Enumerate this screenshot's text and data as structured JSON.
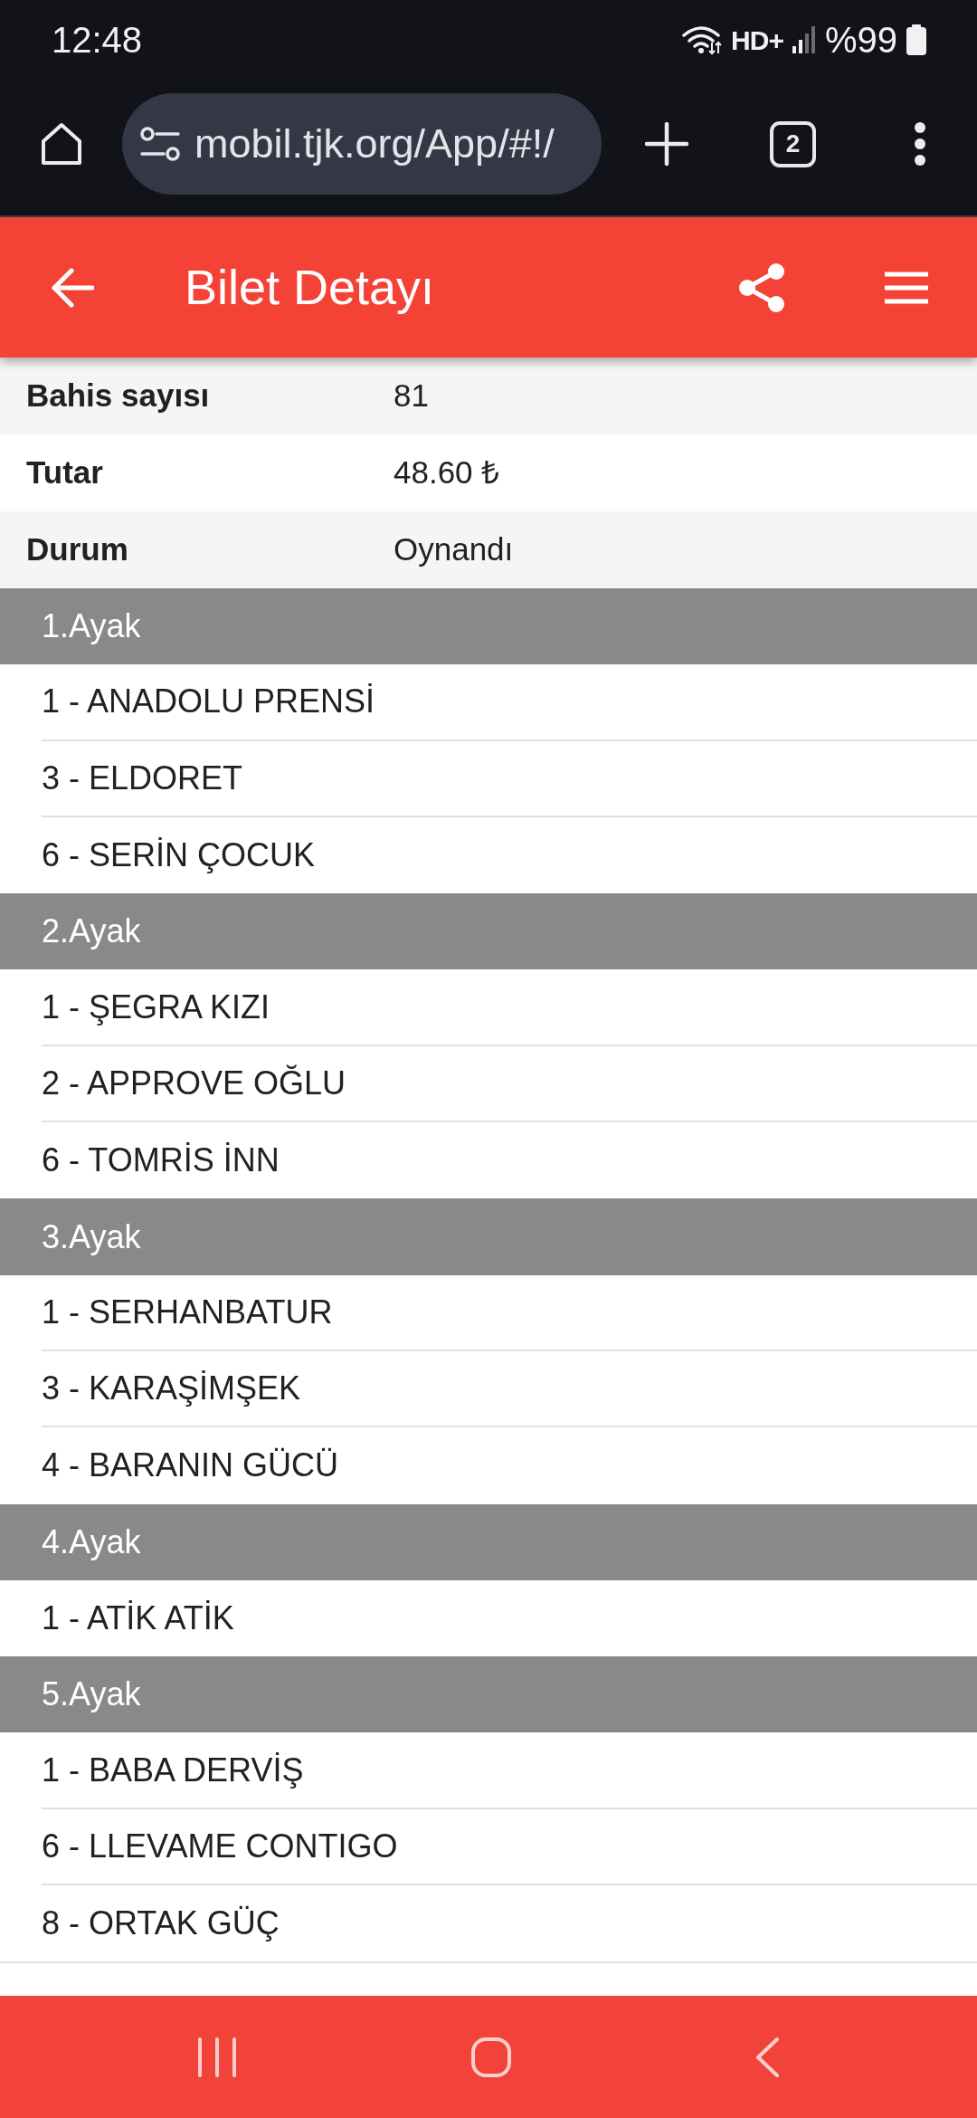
{
  "status_bar": {
    "time": "12:48",
    "hd_indicator": "HD+",
    "battery_text": "%99"
  },
  "browser": {
    "url": "mobil.tjk.org/App/#!/",
    "tab_count": "2"
  },
  "app_bar": {
    "title": "Bilet Detayı"
  },
  "details": [
    {
      "label": "Bahis sayısı",
      "value": "81"
    },
    {
      "label": "Tutar",
      "value": "48.60 ₺"
    },
    {
      "label": "Durum",
      "value": "Oynandı"
    }
  ],
  "legs": [
    {
      "title": "1.Ayak",
      "entries": [
        "1 - ANADOLU PRENSİ",
        "3 - ELDORET",
        "6 - SERİN ÇOCUK"
      ]
    },
    {
      "title": "2.Ayak",
      "entries": [
        "1 - ŞEGRA KIZI",
        "2 - APPROVE OĞLU",
        "6 - TOMRİS İNN"
      ]
    },
    {
      "title": "3.Ayak",
      "entries": [
        "1 - SERHANBATUR",
        "3 - KARAŞİMŞEK",
        "4 - BARANIN GÜCÜ"
      ]
    },
    {
      "title": "4.Ayak",
      "entries": [
        "1 - ATİK ATİK"
      ]
    },
    {
      "title": "5.Ayak",
      "entries": [
        "1 - BABA DERVİŞ",
        "6 - LLEVAME CONTIGO",
        "8 - ORTAK GÜÇ"
      ]
    }
  ]
}
